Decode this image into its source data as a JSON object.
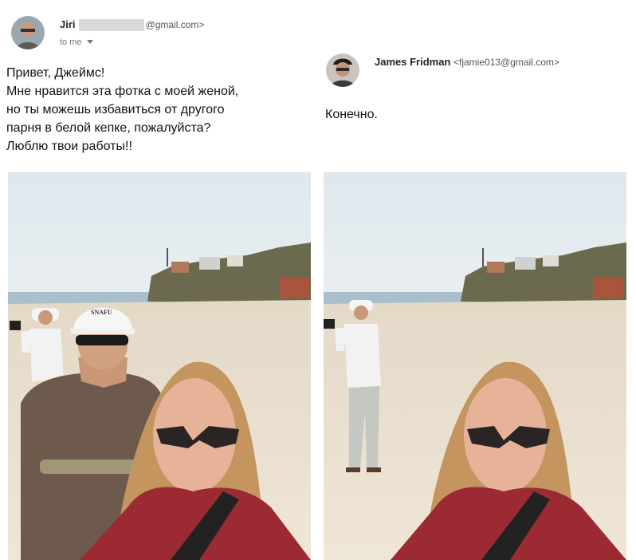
{
  "left": {
    "sender_name": "Jiri",
    "sender_email": "@gmail.com>",
    "recipient_line": "to me",
    "message_lines": [
      "Привет, Джеймс!",
      "Мне нравится эта фотка с моей женой,",
      "но ты можешь избавиться от другого",
      "парня в белой кепке, пожалуйста?",
      "Люблю твои работы!!"
    ],
    "cap_text": "SNAFU"
  },
  "right": {
    "sender_name": "James Fridman",
    "sender_email": "<fjamie013@gmail.com>",
    "message": "Конечно."
  },
  "icons": {
    "dropdown": "chevron-down-icon"
  },
  "colors": {
    "sky": "#dfe7ec",
    "sea": "#9fb8c8",
    "sand": "#eae0d0",
    "shirt_red": "#9b2a33",
    "tshirt_brown": "#6e5a4c"
  }
}
